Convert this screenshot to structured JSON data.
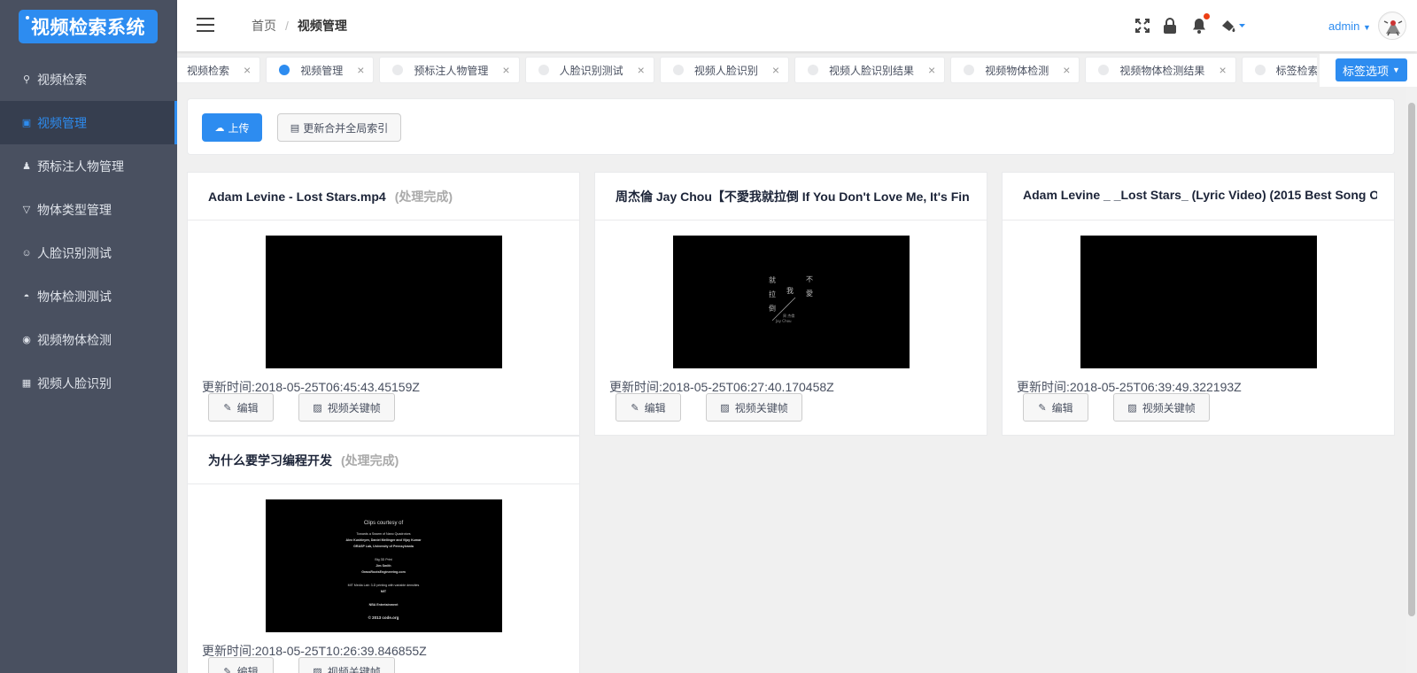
{
  "logo": "视频检索系统",
  "sidebar": {
    "items": [
      {
        "label": "视频检索",
        "icon": "search-icon",
        "glyph": "⚲"
      },
      {
        "label": "视频管理",
        "icon": "video-icon",
        "glyph": "▣"
      },
      {
        "label": "预标注人物管理",
        "icon": "person-icon",
        "glyph": "♟"
      },
      {
        "label": "物体类型管理",
        "icon": "filter-icon",
        "glyph": "▽"
      },
      {
        "label": "人脸识别测试",
        "icon": "face-icon",
        "glyph": "☺"
      },
      {
        "label": "物体检测测试",
        "icon": "car-icon",
        "glyph": "◓"
      },
      {
        "label": "视频物体检测",
        "icon": "target-icon",
        "glyph": "◉"
      },
      {
        "label": "视频人脸识别",
        "icon": "face-frame-icon",
        "glyph": "▦"
      }
    ]
  },
  "header": {
    "breadcrumb_home": "首页",
    "breadcrumb_current": "视频管理",
    "user": "admin"
  },
  "tags": [
    {
      "label": "视频检索"
    },
    {
      "label": "视频管理"
    },
    {
      "label": "预标注人物管理"
    },
    {
      "label": "人脸识别测试"
    },
    {
      "label": "视频人脸识别"
    },
    {
      "label": "视频人脸识别结果"
    },
    {
      "label": "视频物体检测"
    },
    {
      "label": "视频物体检测结果"
    },
    {
      "label": "标签检索结果"
    }
  ],
  "tag_options": "标签选项",
  "toolbar": {
    "upload": "上传",
    "update_index": "更新合并全局索引"
  },
  "cards": [
    {
      "title": "Adam Levine - Lost Stars.mp4",
      "status": "(处理完成)",
      "updated": "更新时间:2018-05-25T06:45:43.45159Z",
      "edit": "编辑",
      "keyframes": "视频关键帧"
    },
    {
      "title": "周杰倫 Jay Chou【不愛我就拉倒 If You Don't Love Me, It's Fine】",
      "status": "",
      "updated": "更新时间:2018-05-25T06:27:40.170458Z",
      "edit": "编辑",
      "keyframes": "视频关键帧"
    },
    {
      "title": "Adam Levine _ _Lost Stars_ (Lyric Video) (2015 Best Song O",
      "status": "",
      "updated": "更新时间:2018-05-25T06:39:49.322193Z",
      "edit": "编辑",
      "keyframes": "视频关键帧"
    },
    {
      "title": "为什么要学习编程开发",
      "status": "(处理完成)",
      "updated": "更新时间:2018-05-25T10:26:39.846855Z",
      "edit": "编辑",
      "keyframes": "视频关键帧"
    }
  ],
  "thumb_jay": {
    "lines": [
      "不",
      "愛",
      "我",
      "就",
      "拉",
      "倒",
      "周 杰倫",
      "Jay Chou"
    ]
  },
  "thumb_credits": {
    "lines": [
      "Clips courtesy of",
      "Towards a Swarm of Nano Quadrotors",
      "Alex Kushleyev, Daniel Mellinger and Vijay Kumar",
      "GRASP Lab, University of Pennsylvania",
      "Big 3D Print",
      "Jim Smith",
      "GrassRootsEngineering.com",
      "MIT Media Lab: 3-D printing with variable densities",
      "MIT",
      "NBA Entertainment",
      "© 2013 code.org"
    ]
  }
}
